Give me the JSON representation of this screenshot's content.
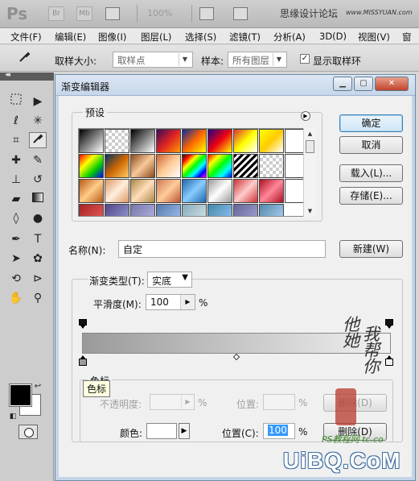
{
  "appbar": {
    "logo": "Ps",
    "bridge": "Br",
    "minibridge": "Mb",
    "zoom": "100%",
    "forum_title": "思缘设计论坛",
    "forum_url": "www.MISSYUAN.com"
  },
  "menu": [
    "文件(F)",
    "编辑(E)",
    "图像(I)",
    "图层(L)",
    "选择(S)",
    "滤镜(T)",
    "分析(A)",
    "3D(D)",
    "视图(V)",
    "窗口"
  ],
  "options": {
    "sample_size_label": "取样大小:",
    "sample_size_value": "取样点",
    "sample_label": "样本:",
    "sample_value": "所有图层",
    "show_ring_label": "显示取样环",
    "show_ring_checked": "✓"
  },
  "dialog": {
    "title": "渐变编辑器",
    "presets_label": "预设",
    "buttons": {
      "ok": "确定",
      "cancel": "取消",
      "load": "载入(L)...",
      "save": "存储(E)...",
      "new": "新建(W)"
    },
    "name_label": "名称(N):",
    "name_value": "自定",
    "gradient_type_label": "渐变类型(T):",
    "gradient_type_value": "实底",
    "smoothness_label": "平滑度(M):",
    "smoothness_value": "100",
    "smoothness_unit": "%",
    "stops_group_label": "色标",
    "opacity_label": "不透明度:",
    "opacity_unit": "%",
    "opacity_location_label": "位置:",
    "opacity_location_unit": "%",
    "delete_opacity": "删除(D)",
    "color_label": "颜色:",
    "color_location_label": "位置(C):",
    "color_location_value": "100",
    "color_location_unit": "%",
    "delete_color": "删除(D)",
    "tooltip": "色标",
    "gradient_start_color": "#9a9a9a",
    "gradient_end_color": "#f2f2f2",
    "left_color_stop_color": "#9a9a9a",
    "right_color_stop_color": "#f2f2f2"
  },
  "watermark": {
    "column1": "他她",
    "column2": "我帮你",
    "green_text": "PS教程网 tc.co",
    "uibq": "UiBQ.CoM"
  }
}
